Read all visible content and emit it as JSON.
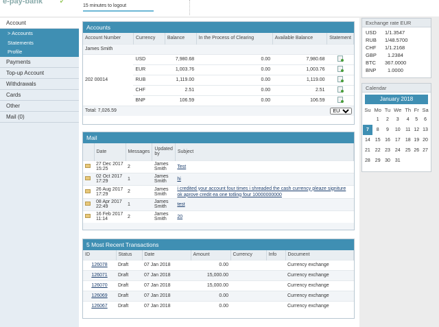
{
  "header": {
    "logo_text": "e-pay-bank",
    "logout_text": "15 minutes to logout"
  },
  "sidebar": {
    "items": [
      {
        "label": "Account"
      },
      {
        "label": "> Accounts"
      },
      {
        "label": "Statements"
      },
      {
        "label": "Profile"
      },
      {
        "label": "Payments"
      },
      {
        "label": "Top-up Account"
      },
      {
        "label": "Withdrawals"
      },
      {
        "label": "Cards"
      },
      {
        "label": "Other"
      },
      {
        "label": "Mail (0)"
      }
    ]
  },
  "accounts": {
    "title": "Accounts",
    "headers": [
      "Account Number",
      "Currency",
      "Balance",
      "In the Process of Clearing",
      "Available Balance",
      "Statement"
    ],
    "owner": "James Smith",
    "account_number": "202 00014",
    "rows": [
      {
        "currency": "USD",
        "balance": "7,980.68",
        "clearing": "0.00",
        "available": "7,980.68"
      },
      {
        "currency": "EUR",
        "balance": "1,003.76",
        "clearing": "0.00",
        "available": "1,003.76"
      },
      {
        "currency": "RUB",
        "balance": "1,119.00",
        "clearing": "0.00",
        "available": "1,119.00"
      },
      {
        "currency": "CHF",
        "balance": "2.51",
        "clearing": "0.00",
        "available": "2.51"
      },
      {
        "currency": "BNP",
        "balance": "106.59",
        "clearing": "0.00",
        "available": "106.59"
      }
    ],
    "total": "Total: 7,026.59",
    "total_currency": "EUR"
  },
  "mail": {
    "title": "Mail",
    "headers": [
      "Date",
      "Messages",
      "Updated by",
      "Subject"
    ],
    "rows": [
      {
        "date": "27 Dec 2017 15:25",
        "messages": "2",
        "updated_by": "James Smith",
        "subject": "Test"
      },
      {
        "date": "02 Oct 2017 17:29",
        "messages": "1",
        "updated_by": "James Smith",
        "subject": "hi"
      },
      {
        "date": "26 Aug 2017 17:29",
        "messages": "2",
        "updated_by": "James Smith",
        "subject": "i credited your account four times i shreaded the cash currency pleaze signiture ok aprove credit ea one totling four 10000000000"
      },
      {
        "date": "08 Apr 2017 22:49",
        "messages": "1",
        "updated_by": "James Smith",
        "subject": "test"
      },
      {
        "date": "16 Feb 2017 11:14",
        "messages": "2",
        "updated_by": "James Smith",
        "subject": "20"
      }
    ]
  },
  "transactions": {
    "title": "5 Most Recent Transactions",
    "headers": [
      "ID",
      "Status",
      "Date",
      "Amount",
      "Currency",
      "Info",
      "Document"
    ],
    "rows": [
      {
        "id": "126078",
        "status": "Draft",
        "date": "07 Jan 2018",
        "amount": "0.00",
        "currency": "",
        "info": "",
        "document": "Currency exchange"
      },
      {
        "id": "126071",
        "status": "Draft",
        "date": "07 Jan 2018",
        "amount": "15,000.00",
        "currency": "",
        "info": "",
        "document": "Currency exchange"
      },
      {
        "id": "126070",
        "status": "Draft",
        "date": "07 Jan 2018",
        "amount": "15,000.00",
        "currency": "",
        "info": "",
        "document": "Currency exchange"
      },
      {
        "id": "126069",
        "status": "Draft",
        "date": "07 Jan 2018",
        "amount": "0.00",
        "currency": "",
        "info": "",
        "document": "Currency exchange"
      },
      {
        "id": "126067",
        "status": "Draft",
        "date": "07 Jan 2018",
        "amount": "0.00",
        "currency": "",
        "info": "",
        "document": "Currency exchange"
      }
    ]
  },
  "exchange": {
    "title": "Exchange rate EUR",
    "rates": [
      {
        "code": "USD",
        "rate": "1/1.3547"
      },
      {
        "code": "RUB",
        "rate": "1/48.5700"
      },
      {
        "code": "CHF",
        "rate": "1/1.2168"
      },
      {
        "code": "GBP",
        "rate": "1.2384"
      },
      {
        "code": "BTC",
        "rate": "367.0000"
      },
      {
        "code": "BNP",
        "rate": "1.0000"
      }
    ]
  },
  "calendar": {
    "title": "Calendar",
    "month": "January 2018",
    "weekdays": [
      "Su",
      "Mo",
      "Tu",
      "We",
      "Th",
      "Fr",
      "Sa"
    ],
    "weeks": [
      [
        "",
        "1",
        "2",
        "3",
        "4",
        "5",
        "6"
      ],
      [
        "7",
        "8",
        "9",
        "10",
        "11",
        "12",
        "13"
      ],
      [
        "14",
        "15",
        "16",
        "17",
        "18",
        "19",
        "20"
      ],
      [
        "21",
        "22",
        "23",
        "24",
        "25",
        "26",
        "27"
      ],
      [
        "28",
        "29",
        "30",
        "31",
        "",
        "",
        ""
      ]
    ],
    "today": "7"
  },
  "colors": {
    "accent": "#3f8fb3",
    "sidebar_bg": "#e6edf3"
  }
}
